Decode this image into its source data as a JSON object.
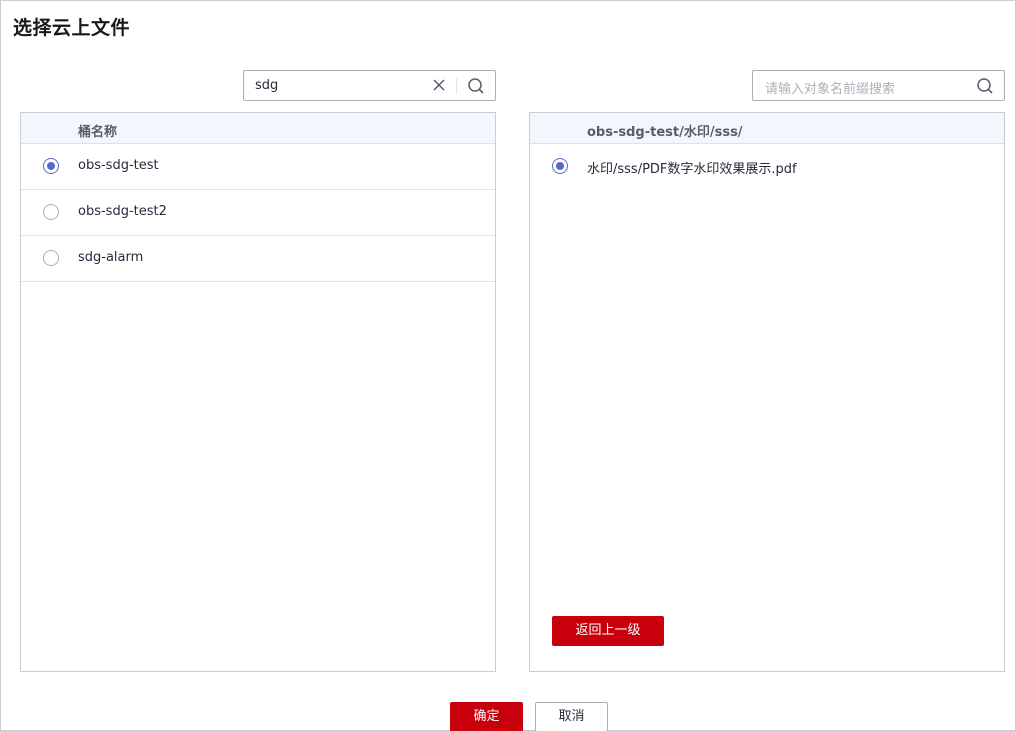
{
  "dialog": {
    "title": "选择云上文件"
  },
  "left": {
    "search_value": "sdg",
    "column_header": "桶名称",
    "rows": [
      {
        "label": "obs-sdg-test",
        "selected": true
      },
      {
        "label": "obs-sdg-test2",
        "selected": false
      },
      {
        "label": "sdg-alarm",
        "selected": false
      }
    ]
  },
  "right": {
    "search_placeholder": "请输入对象名前缀搜索",
    "column_header": "obs-sdg-test/水印/sss/",
    "rows": [
      {
        "label": "水印/sss/PDF数字水印效果展示.pdf",
        "selected": true
      }
    ],
    "back_label": "返回上一级"
  },
  "footer": {
    "confirm_label": "确定",
    "cancel_label": "取消"
  },
  "icons": {
    "clear": "close-icon",
    "search": "search-icon"
  },
  "colors": {
    "primary": "#c7000b",
    "radio_selected": "#526ecc",
    "header_bg": "#f3f6fc"
  }
}
